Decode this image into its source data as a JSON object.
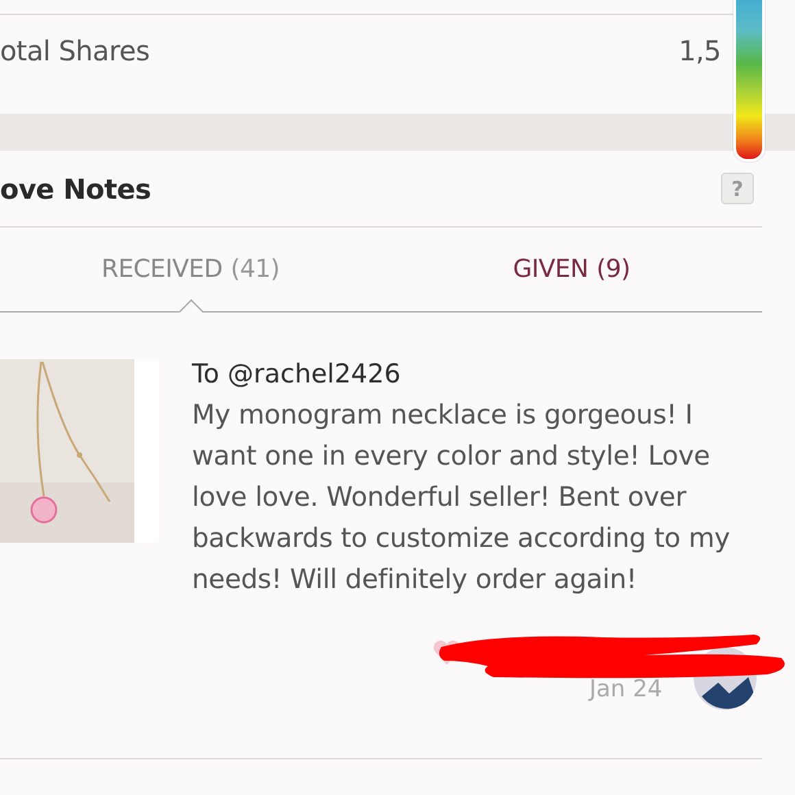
{
  "stats": {
    "label": "otal Shares",
    "value": "1,5"
  },
  "section": {
    "title": "ove Notes",
    "help": "?"
  },
  "tabs": [
    {
      "label": "RECEIVED",
      "count": "(41)",
      "selected": true
    },
    {
      "label": "GIVEN",
      "count": "(9)",
      "selected": false
    }
  ],
  "note": {
    "recipient": "To @rachel2426",
    "message": "My monogram necklace is gorgeous! I want one in every color and style! Love love love. Wonderful seller! Bent over backwards to customize according to my needs! Will definitely order again!",
    "date": "Jan 24"
  }
}
